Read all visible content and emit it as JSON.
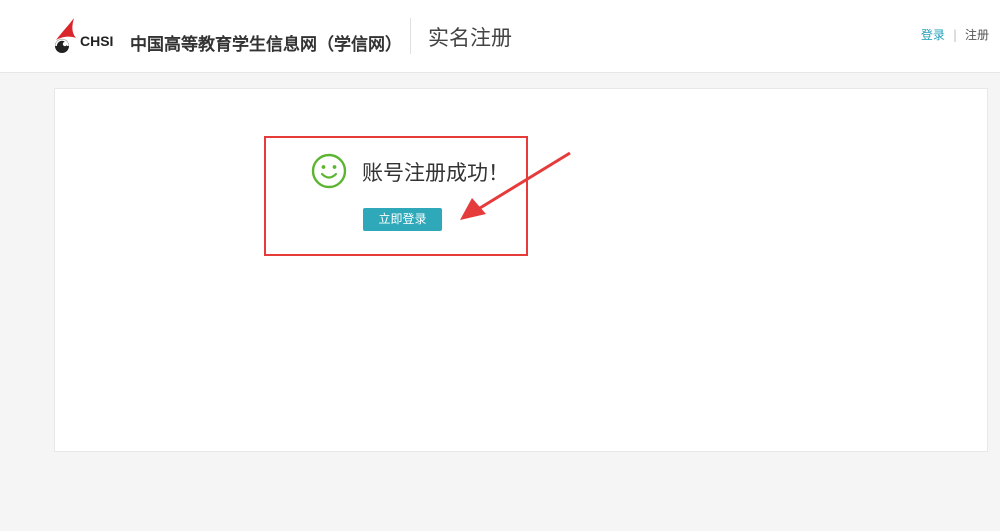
{
  "header": {
    "logo_text": "CHSI",
    "site_name": "中国高等教育学生信息网（学信网）",
    "page_title": "实名注册",
    "login_link": "登录",
    "separator": "|",
    "register_link": "注册"
  },
  "main": {
    "success_message": "账号注册成功！",
    "login_button": "立即登录"
  },
  "colors": {
    "accent": "#2fa9b9",
    "success_green": "#5cb531",
    "annotation_red": "#e63b3b",
    "logo_red": "#d9262c"
  },
  "icons": {
    "logo": "chsi-logo-icon",
    "success": "smile-icon",
    "annotation": "red-arrow-icon"
  }
}
